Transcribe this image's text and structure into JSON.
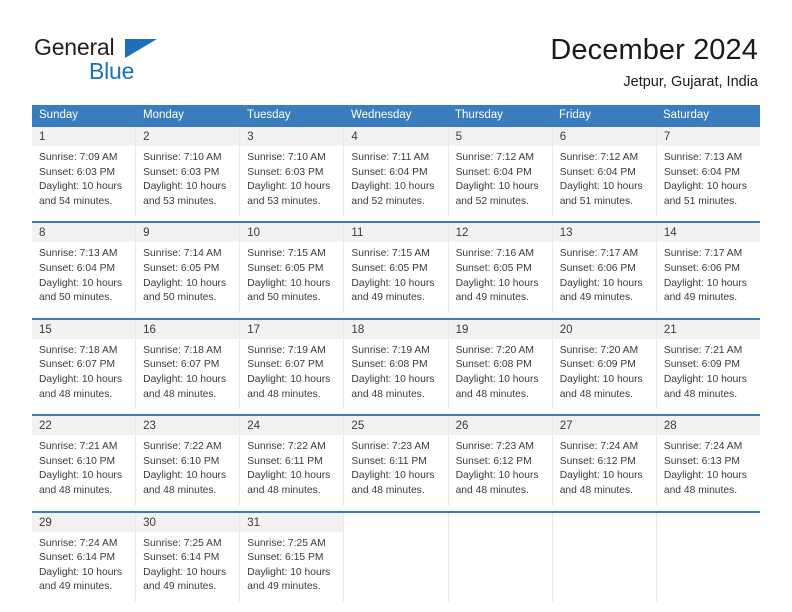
{
  "brand": {
    "name_part1": "General",
    "name_part2": "Blue",
    "accent_color": "#1d70b7",
    "triangle_icon": "triangle-icon"
  },
  "header": {
    "title": "December 2024",
    "subtitle": "Jetpur, Gujarat, India"
  },
  "calendar": {
    "header_bg": "#3a7dbf",
    "header_text_color": "#ffffff",
    "weekdays": [
      "Sunday",
      "Monday",
      "Tuesday",
      "Wednesday",
      "Thursday",
      "Friday",
      "Saturday"
    ],
    "weeks": [
      [
        {
          "day": "1",
          "lines": [
            "Sunrise: 7:09 AM",
            "Sunset: 6:03 PM",
            "Daylight: 10 hours",
            "and 54 minutes."
          ]
        },
        {
          "day": "2",
          "lines": [
            "Sunrise: 7:10 AM",
            "Sunset: 6:03 PM",
            "Daylight: 10 hours",
            "and 53 minutes."
          ]
        },
        {
          "day": "3",
          "lines": [
            "Sunrise: 7:10 AM",
            "Sunset: 6:03 PM",
            "Daylight: 10 hours",
            "and 53 minutes."
          ]
        },
        {
          "day": "4",
          "lines": [
            "Sunrise: 7:11 AM",
            "Sunset: 6:04 PM",
            "Daylight: 10 hours",
            "and 52 minutes."
          ]
        },
        {
          "day": "5",
          "lines": [
            "Sunrise: 7:12 AM",
            "Sunset: 6:04 PM",
            "Daylight: 10 hours",
            "and 52 minutes."
          ]
        },
        {
          "day": "6",
          "lines": [
            "Sunrise: 7:12 AM",
            "Sunset: 6:04 PM",
            "Daylight: 10 hours",
            "and 51 minutes."
          ]
        },
        {
          "day": "7",
          "lines": [
            "Sunrise: 7:13 AM",
            "Sunset: 6:04 PM",
            "Daylight: 10 hours",
            "and 51 minutes."
          ]
        }
      ],
      [
        {
          "day": "8",
          "lines": [
            "Sunrise: 7:13 AM",
            "Sunset: 6:04 PM",
            "Daylight: 10 hours",
            "and 50 minutes."
          ]
        },
        {
          "day": "9",
          "lines": [
            "Sunrise: 7:14 AM",
            "Sunset: 6:05 PM",
            "Daylight: 10 hours",
            "and 50 minutes."
          ]
        },
        {
          "day": "10",
          "lines": [
            "Sunrise: 7:15 AM",
            "Sunset: 6:05 PM",
            "Daylight: 10 hours",
            "and 50 minutes."
          ]
        },
        {
          "day": "11",
          "lines": [
            "Sunrise: 7:15 AM",
            "Sunset: 6:05 PM",
            "Daylight: 10 hours",
            "and 49 minutes."
          ]
        },
        {
          "day": "12",
          "lines": [
            "Sunrise: 7:16 AM",
            "Sunset: 6:05 PM",
            "Daylight: 10 hours",
            "and 49 minutes."
          ]
        },
        {
          "day": "13",
          "lines": [
            "Sunrise: 7:17 AM",
            "Sunset: 6:06 PM",
            "Daylight: 10 hours",
            "and 49 minutes."
          ]
        },
        {
          "day": "14",
          "lines": [
            "Sunrise: 7:17 AM",
            "Sunset: 6:06 PM",
            "Daylight: 10 hours",
            "and 49 minutes."
          ]
        }
      ],
      [
        {
          "day": "15",
          "lines": [
            "Sunrise: 7:18 AM",
            "Sunset: 6:07 PM",
            "Daylight: 10 hours",
            "and 48 minutes."
          ]
        },
        {
          "day": "16",
          "lines": [
            "Sunrise: 7:18 AM",
            "Sunset: 6:07 PM",
            "Daylight: 10 hours",
            "and 48 minutes."
          ]
        },
        {
          "day": "17",
          "lines": [
            "Sunrise: 7:19 AM",
            "Sunset: 6:07 PM",
            "Daylight: 10 hours",
            "and 48 minutes."
          ]
        },
        {
          "day": "18",
          "lines": [
            "Sunrise: 7:19 AM",
            "Sunset: 6:08 PM",
            "Daylight: 10 hours",
            "and 48 minutes."
          ]
        },
        {
          "day": "19",
          "lines": [
            "Sunrise: 7:20 AM",
            "Sunset: 6:08 PM",
            "Daylight: 10 hours",
            "and 48 minutes."
          ]
        },
        {
          "day": "20",
          "lines": [
            "Sunrise: 7:20 AM",
            "Sunset: 6:09 PM",
            "Daylight: 10 hours",
            "and 48 minutes."
          ]
        },
        {
          "day": "21",
          "lines": [
            "Sunrise: 7:21 AM",
            "Sunset: 6:09 PM",
            "Daylight: 10 hours",
            "and 48 minutes."
          ]
        }
      ],
      [
        {
          "day": "22",
          "lines": [
            "Sunrise: 7:21 AM",
            "Sunset: 6:10 PM",
            "Daylight: 10 hours",
            "and 48 minutes."
          ]
        },
        {
          "day": "23",
          "lines": [
            "Sunrise: 7:22 AM",
            "Sunset: 6:10 PM",
            "Daylight: 10 hours",
            "and 48 minutes."
          ]
        },
        {
          "day": "24",
          "lines": [
            "Sunrise: 7:22 AM",
            "Sunset: 6:11 PM",
            "Daylight: 10 hours",
            "and 48 minutes."
          ]
        },
        {
          "day": "25",
          "lines": [
            "Sunrise: 7:23 AM",
            "Sunset: 6:11 PM",
            "Daylight: 10 hours",
            "and 48 minutes."
          ]
        },
        {
          "day": "26",
          "lines": [
            "Sunrise: 7:23 AM",
            "Sunset: 6:12 PM",
            "Daylight: 10 hours",
            "and 48 minutes."
          ]
        },
        {
          "day": "27",
          "lines": [
            "Sunrise: 7:24 AM",
            "Sunset: 6:12 PM",
            "Daylight: 10 hours",
            "and 48 minutes."
          ]
        },
        {
          "day": "28",
          "lines": [
            "Sunrise: 7:24 AM",
            "Sunset: 6:13 PM",
            "Daylight: 10 hours",
            "and 48 minutes."
          ]
        }
      ],
      [
        {
          "day": "29",
          "lines": [
            "Sunrise: 7:24 AM",
            "Sunset: 6:14 PM",
            "Daylight: 10 hours",
            "and 49 minutes."
          ]
        },
        {
          "day": "30",
          "lines": [
            "Sunrise: 7:25 AM",
            "Sunset: 6:14 PM",
            "Daylight: 10 hours",
            "and 49 minutes."
          ]
        },
        {
          "day": "31",
          "lines": [
            "Sunrise: 7:25 AM",
            "Sunset: 6:15 PM",
            "Daylight: 10 hours",
            "and 49 minutes."
          ]
        },
        {
          "day": "",
          "lines": []
        },
        {
          "day": "",
          "lines": []
        },
        {
          "day": "",
          "lines": []
        },
        {
          "day": "",
          "lines": []
        }
      ]
    ]
  }
}
